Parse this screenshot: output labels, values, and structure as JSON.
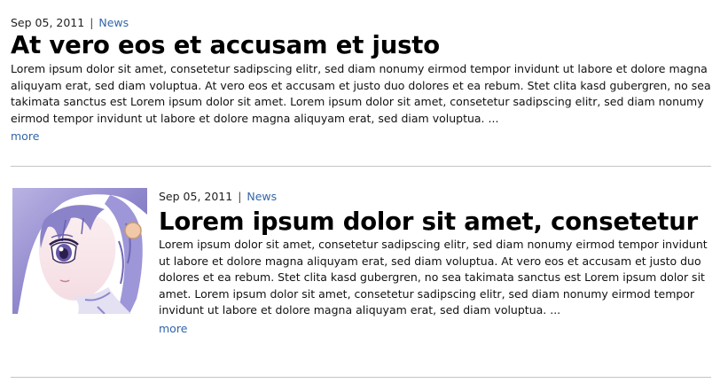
{
  "posts": [
    {
      "date": "Sep 05, 2011",
      "separator": "|",
      "category": "News",
      "title": "At vero eos et accusam et justo",
      "body": "Lorem ipsum dolor sit amet, consetetur sadipscing elitr, sed diam nonumy eirmod tempor invidunt ut labore et dolore magna aliquyam erat, sed diam voluptua. At vero eos et accusam et justo duo dolores et ea rebum. Stet clita kasd gubergren, no sea takimata sanctus est Lorem ipsum dolor sit amet. Lorem ipsum dolor sit amet, consetetur sadipscing elitr, sed diam nonumy eirmod tempor invidunt ut labore et dolore magna aliquyam erat, sed diam voluptua. ...",
      "more": "more"
    },
    {
      "date": "Sep 05, 2011",
      "separator": "|",
      "category": "News",
      "title": "Lorem ipsum dolor sit amet, consetetur",
      "body": "Lorem ipsum dolor sit amet, consetetur sadipscing elitr, sed diam nonumy eirmod tempor invidunt ut labore et dolore magna aliquyam erat, sed diam voluptua. At vero eos et accusam et justo duo dolores et ea rebum. Stet clita kasd gubergren, no sea takimata sanctus est Lorem ipsum dolor sit amet. Lorem ipsum dolor sit amet, consetetur sadipscing elitr, sed diam nonumy eirmod tempor invidunt ut labore et dolore magna aliquyam erat, sed diam voluptua. ...",
      "more": "more",
      "thumbnail": "anime-girl-thumbnail"
    }
  ],
  "colors": {
    "link": "#3366aa",
    "divider": "#c4c4c4",
    "text": "#111111"
  }
}
